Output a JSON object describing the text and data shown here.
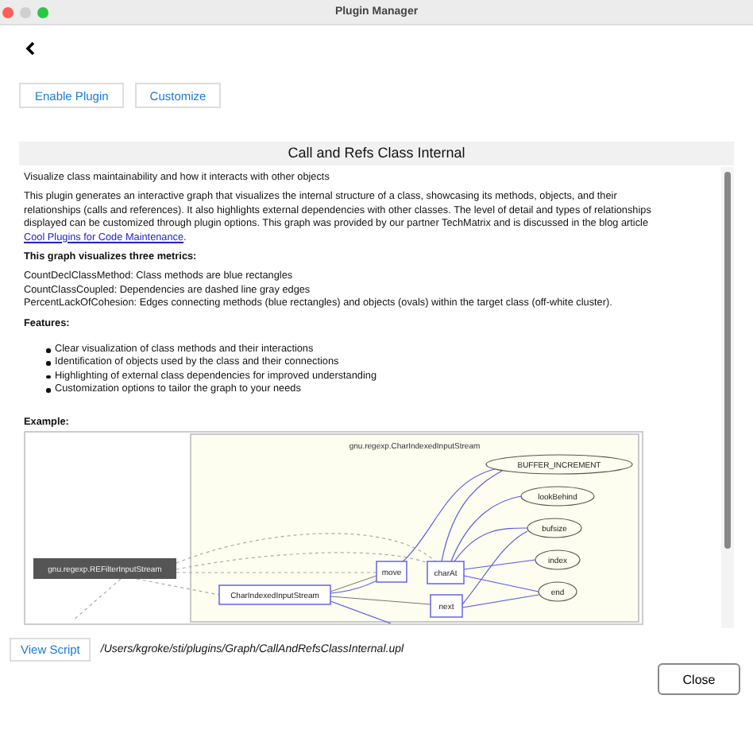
{
  "window": {
    "title": "Plugin Manager"
  },
  "buttons": [
    "Enable Plugin",
    "Customize"
  ],
  "plugin": {
    "title": "Call and Refs Class Internal",
    "summary": "Visualize class maintainability and how it interacts with other objects",
    "description": "This plugin generates an interactive graph that visualizes the internal structure of a class, showcasing its methods, objects, and their relationships (calls and references). It also highlights external dependencies with other classes. The level of detail and types of relationships displayed can be customized through plugin options. This graph was provided by our partner TechMatrix and is discussed in the blog article ",
    "link": "Cool Plugins for Code Maintenance",
    "description_end": ".",
    "metrics_heading": "This graph visualizes three metrics:",
    "metrics": [
      "CountDeclClassMethod: Class methods are blue rectangles",
      "CountClassCoupled: Dependencies are dashed line gray edges",
      "PercentLackOfCohesion: Edges connecting methods (blue rectangles) and objects (ovals) within the target class (off-white cluster)."
    ],
    "features_heading": "Features:",
    "features": [
      "Clear visualization of class methods and their interactions",
      "Identification of objects used by the class and their connections",
      "Highlighting of external class dependencies for improved understanding",
      "Customization options to tailor the graph to your needs"
    ],
    "example_heading": "Example:",
    "example_graph": {
      "cluster_title": "gnu.regexp.CharIndexedInputStream",
      "nodes": [
        {
          "label": "BUFFER_INCREMENT",
          "kind": "object"
        },
        {
          "label": "lookBehind",
          "kind": "object"
        },
        {
          "label": "bufsize",
          "kind": "object"
        },
        {
          "label": "index",
          "kind": "object"
        },
        {
          "label": "end",
          "kind": "object"
        },
        {
          "label": "gnu.regexp.REFilterInputStream",
          "kind": "external"
        },
        {
          "label": "move",
          "kind": "method"
        },
        {
          "label": "charAt",
          "kind": "method"
        },
        {
          "label": "CharIndexedInputStream",
          "kind": "method"
        },
        {
          "label": "next",
          "kind": "method"
        }
      ]
    }
  },
  "script": {
    "button": "View Script",
    "path": "/Users/kgroke/sti/plugins/Graph/CallAndRefsClassInternal.upl"
  },
  "footer_buttons": [
    "Close"
  ]
}
